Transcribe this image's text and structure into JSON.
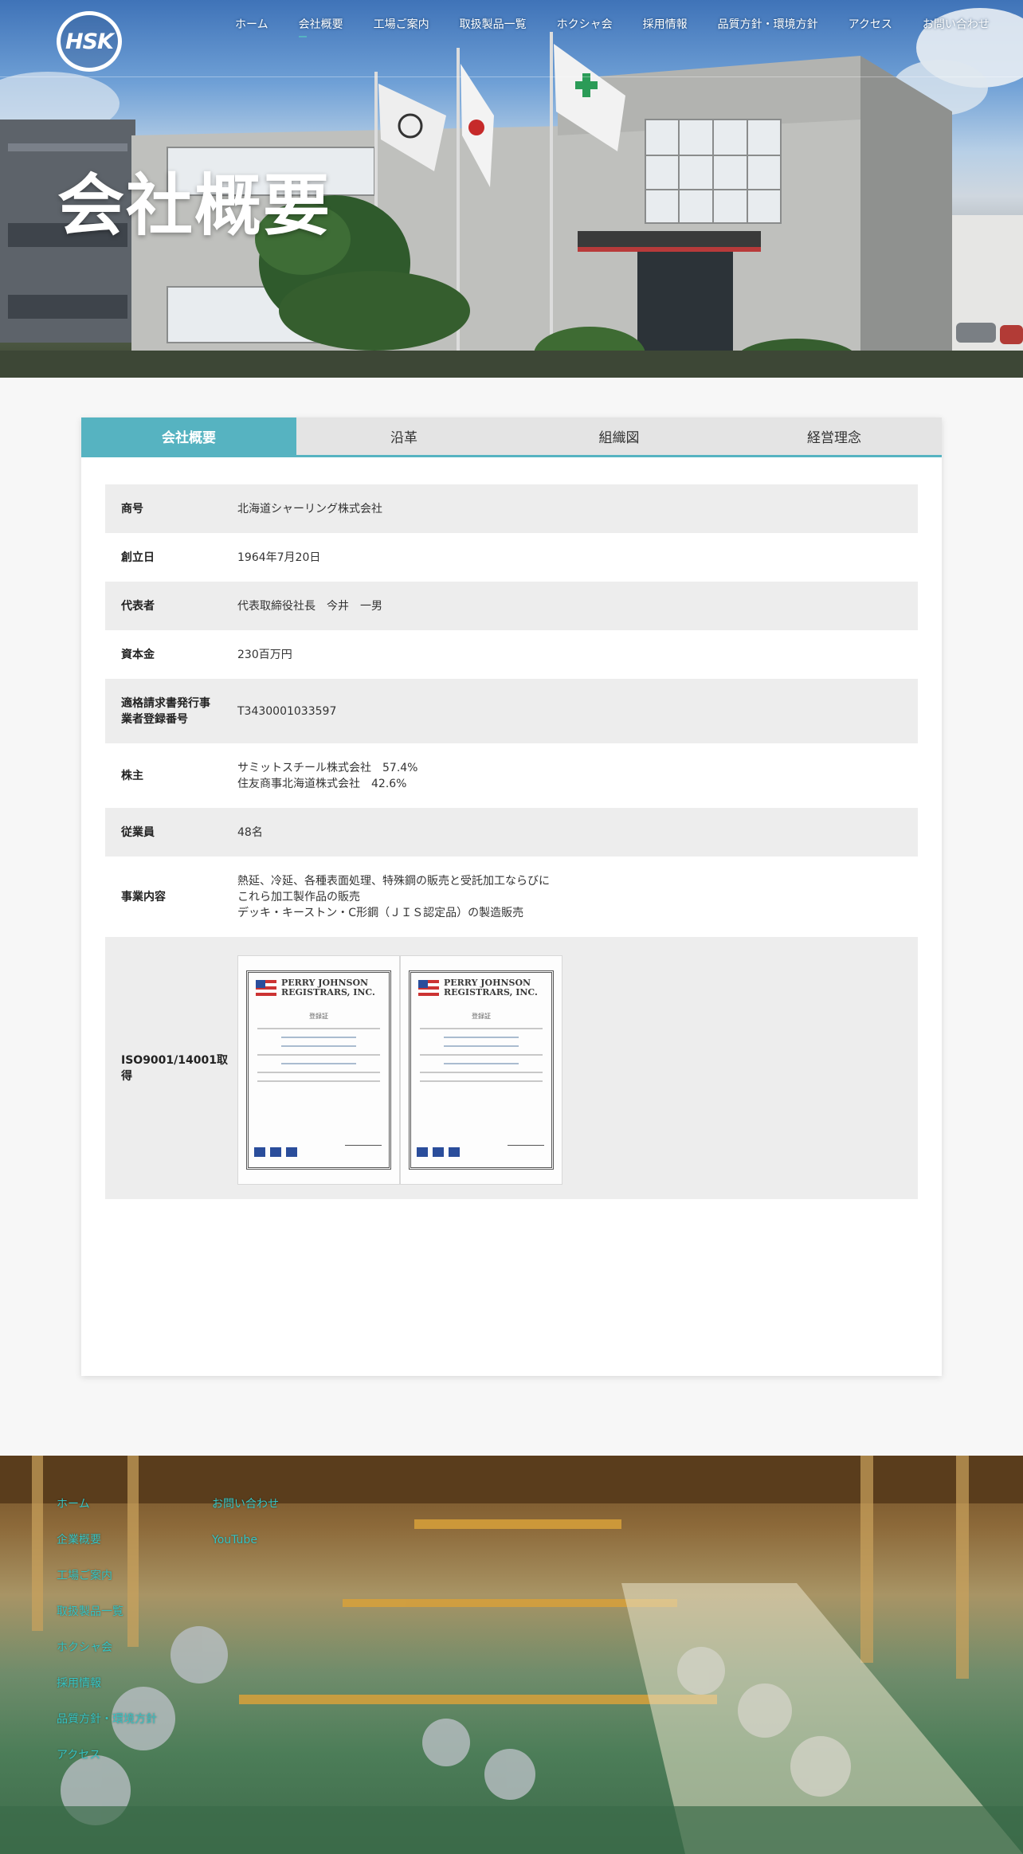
{
  "logo": {
    "text": "HSK"
  },
  "nav": {
    "items": [
      {
        "label": "ホーム"
      },
      {
        "label": "会社概要"
      },
      {
        "label": "工場ご案内"
      },
      {
        "label": "取扱製品一覧"
      },
      {
        "label": "ホクシャ会"
      },
      {
        "label": "採用情報"
      },
      {
        "label": "品質方針・環境方針"
      },
      {
        "label": "アクセス"
      },
      {
        "label": "お問い合わせ"
      }
    ]
  },
  "hero": {
    "title": "会社概要"
  },
  "tabs": [
    {
      "label": "会社概要"
    },
    {
      "label": "沿革"
    },
    {
      "label": "組織図"
    },
    {
      "label": "経営理念"
    }
  ],
  "info": {
    "rows": [
      {
        "key": "商号",
        "value": "北海道シャーリング株式会社"
      },
      {
        "key": "創立日",
        "value": "1964年7月20日"
      },
      {
        "key": "代表者",
        "value": "代表取締役社長　今井　一男"
      },
      {
        "key": "資本金",
        "value": "230百万円"
      },
      {
        "key_line1": "適格請求書発行事",
        "key_line2": "業者登録番号",
        "value": "T3430001033597"
      },
      {
        "key": "株主",
        "value_line1": "サミットスチール株式会社　57.4%",
        "value_line2": "住友商事北海道株式会社　42.6%"
      },
      {
        "key": "従業員",
        "value": "48名"
      },
      {
        "key": "事業内容",
        "value_line1": "熱延、冷延、各種表面処理、特殊鋼の販売と受託加工ならびに",
        "value_line2": "これら加工製作品の販売",
        "value_line3": "デッキ・キーストン・C形鋼（ＪＩＳ認定品）の製造販売"
      },
      {
        "key_line1": "ISO9001/14001取",
        "key_line2": "得"
      }
    ]
  },
  "certificates": [
    {
      "issuer_line1": "PERRY JOHNSON",
      "issuer_line2": "REGISTRARS, INC.",
      "heading": "登録証"
    },
    {
      "issuer_line1": "PERRY JOHNSON",
      "issuer_line2": "REGISTRARS, INC.",
      "heading": "登録証"
    }
  ],
  "footer": {
    "col1": [
      {
        "label": "ホーム"
      },
      {
        "label": "企業概要"
      },
      {
        "label": "工場ご案内"
      },
      {
        "label": "取扱製品一覧"
      },
      {
        "label": "ホクシャ会"
      },
      {
        "label": "採用情報"
      },
      {
        "label": "品質方針・環境方針"
      },
      {
        "label": "アクセス"
      }
    ],
    "col2": [
      {
        "label": "お問い合わせ"
      },
      {
        "label": "YouTube"
      }
    ]
  },
  "colors": {
    "accent": "#56b3c1",
    "footer_link": "#35c4c4",
    "row_gray": "#ededed"
  }
}
